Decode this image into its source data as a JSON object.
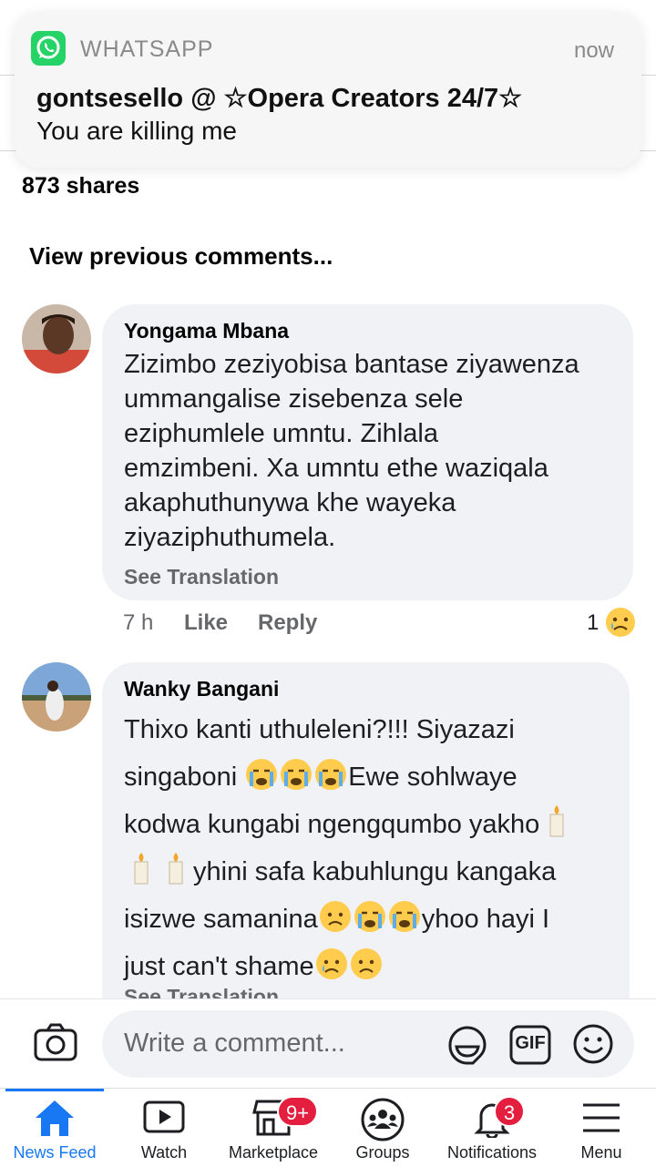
{
  "notification": {
    "app_name": "WHATSAPP",
    "time": "now",
    "title": "gontsesello @ ☆Opera Creators 24/7☆",
    "body": "You are killing me"
  },
  "post": {
    "shares": "873 shares",
    "view_previous": "View previous comments..."
  },
  "comments": [
    {
      "author": "Yongama Mbana",
      "lines": [
        "Zizimbo zeziyobisa bantase ziyawenza",
        "ummangalise zisebenza sele",
        "eziphumlele umntu. Zihlala",
        "emzimbeni. Xa umntu ethe waziqala",
        "akaphuthunywa khe wayeka",
        "ziyaziphuthumela."
      ],
      "see_translation": "See Translation",
      "time": "7 h",
      "like": "Like",
      "reply": "Reply",
      "reaction_count": "1"
    },
    {
      "author": "Wanky Bangani",
      "text": {
        "l1": "Thixo kanti uthuleleni?!!! Siyazazi",
        "l2": "singaboni",
        "l2b": "Ewe sohlwaye",
        "l3": "kodwa kungabi ngengqumbo yakho",
        "l4": "yhini safa kabuhlungu kangaka",
        "l5a": "isizwe samanina",
        "l5b": "yhoo hayi I",
        "l6": "just can't shame"
      },
      "see_translation": "See Translation"
    }
  ],
  "composer": {
    "placeholder": "Write a comment...",
    "gif_label": "GIF"
  },
  "tabbar": {
    "tabs": [
      {
        "label": "News Feed"
      },
      {
        "label": "Watch"
      },
      {
        "label": "Marketplace",
        "badge": "9+"
      },
      {
        "label": "Groups"
      },
      {
        "label": "Notifications",
        "badge": "3"
      },
      {
        "label": "Menu"
      }
    ]
  },
  "colors": {
    "accent": "#1877f2",
    "badge": "#e41e3f",
    "bubble": "#f0f2f5",
    "whatsapp": "#25d366"
  }
}
